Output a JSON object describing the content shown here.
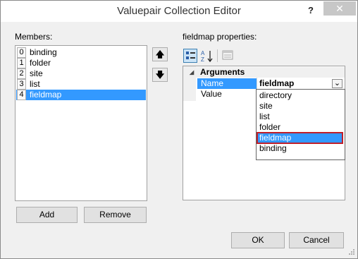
{
  "window": {
    "title": "Valuepair Collection Editor",
    "help_glyph": "?",
    "close_glyph": "✕"
  },
  "members": {
    "label": "Members:",
    "items": [
      {
        "index": "0",
        "label": "binding"
      },
      {
        "index": "1",
        "label": "folder"
      },
      {
        "index": "2",
        "label": "site"
      },
      {
        "index": "3",
        "label": "list"
      },
      {
        "index": "4",
        "label": "fieldmap"
      }
    ],
    "selected_index": 4,
    "move_up_glyph": "🡅",
    "move_down_glyph": "🡇",
    "add_label": "Add",
    "remove_label": "Remove"
  },
  "properties": {
    "label": "fieldmap properties:",
    "toolbar": {
      "sort_az_label": "AZ"
    },
    "category": {
      "expand_glyph": "◢",
      "label": "Arguments"
    },
    "rows": [
      {
        "name": "Name",
        "value": "fieldmap"
      },
      {
        "name": "Value",
        "value": ""
      }
    ],
    "dropdown_arrow_glyph": "⌄",
    "dropdown_options": [
      "directory",
      "site",
      "list",
      "folder",
      "fieldmap",
      "binding"
    ],
    "dropdown_selected": 4
  },
  "footer": {
    "ok_label": "OK",
    "cancel_label": "Cancel"
  },
  "colors": {
    "selection": "#3399ff",
    "highlight_border": "#c0202a",
    "background": "#f0f0f0"
  }
}
